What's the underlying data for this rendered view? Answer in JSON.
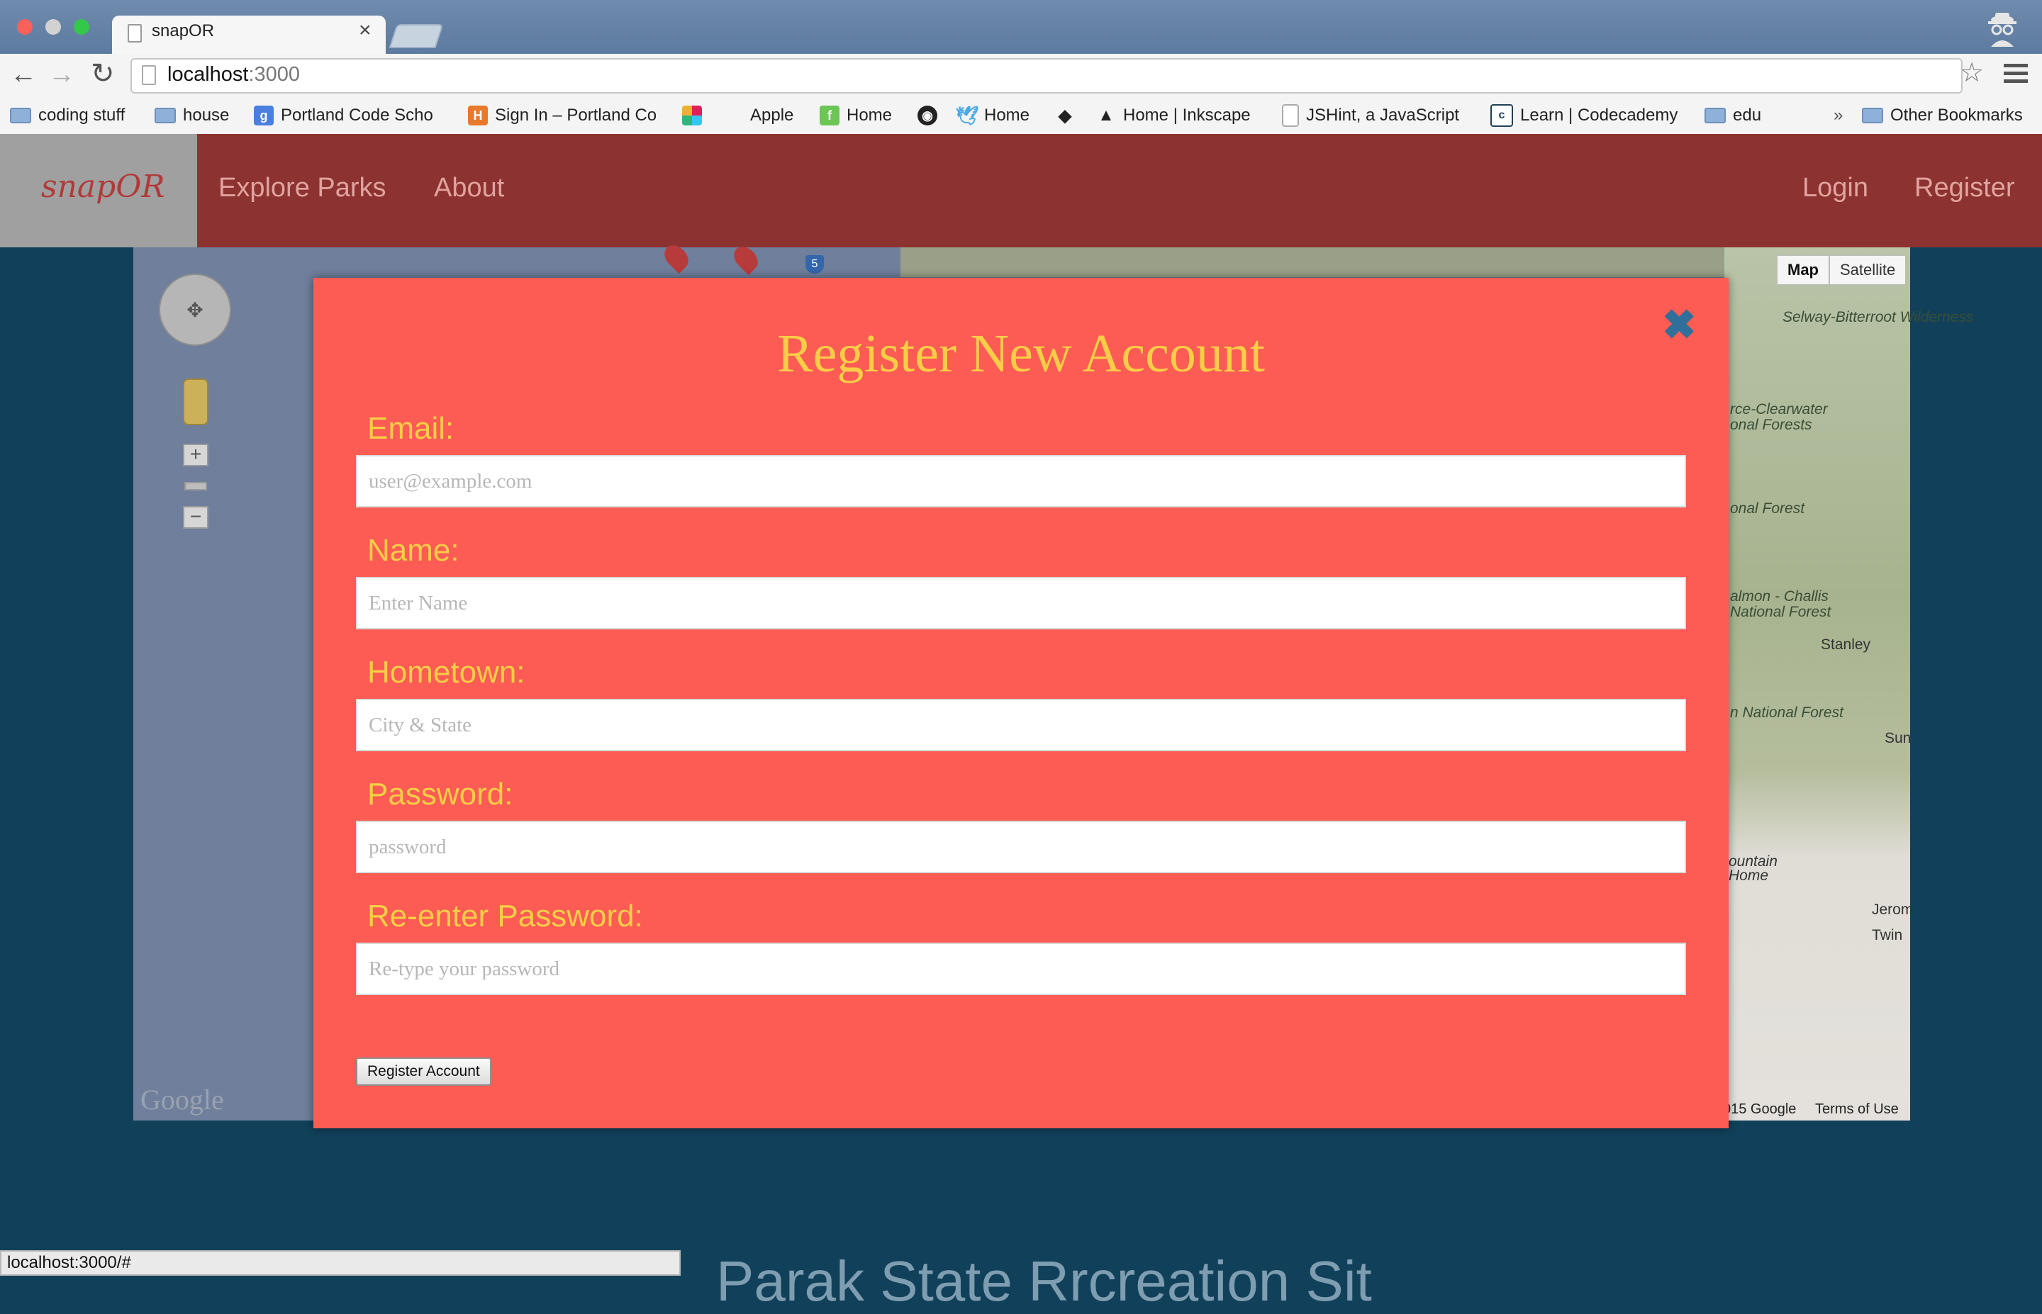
{
  "browser": {
    "tab_title": "snapOR",
    "url_host": "localhost",
    "url_port": ":3000",
    "bookmarks": [
      {
        "label": "coding stuff",
        "icon": "folder-icon"
      },
      {
        "label": "house",
        "icon": "folder-icon"
      },
      {
        "label": "Portland Code Scho",
        "icon": "google-sites-icon"
      },
      {
        "label": "Sign In – Portland Co",
        "icon": "h-icon"
      },
      {
        "label": "",
        "icon": "slack-icon"
      },
      {
        "label": "Apple",
        "icon": "apple-icon"
      },
      {
        "label": "Home",
        "icon": "feedly-icon"
      },
      {
        "label": "",
        "icon": "github-icon"
      },
      {
        "label": "Home",
        "icon": "twitter-icon"
      },
      {
        "label": "",
        "icon": "gem-icon"
      },
      {
        "label": "Home | Inkscape",
        "icon": "inkscape-icon"
      },
      {
        "label": "JSHint, a JavaScript",
        "icon": "page-icon"
      },
      {
        "label": "Learn | Codecademy",
        "icon": "codecademy-icon"
      },
      {
        "label": "edu",
        "icon": "folder-icon"
      }
    ],
    "overflow_chevron": "»",
    "other_bookmarks": "Other Bookmarks",
    "status_url": "localhost:3000/#"
  },
  "site": {
    "logo": "snapOR",
    "nav": [
      "Explore Parks",
      "About"
    ],
    "auth": [
      "Login",
      "Register"
    ],
    "bottom_heading": "Parak State Rrcreation Sit"
  },
  "map": {
    "type_buttons": [
      "Map",
      "Satellite"
    ],
    "active_type": "Map",
    "labels": [
      "Selway-Bitterroot Wilderness",
      "rce-Clearwater",
      "onal Forests",
      "onal Forest",
      "almon - Challis",
      "National Forest",
      "n National Forest",
      "ountain",
      "Home"
    ],
    "towns": [
      "Stanley",
      "Sun",
      "Jerom",
      "Twin"
    ],
    "interstate": "5",
    "google_logo": "Google",
    "copyright": "015 Google",
    "terms": "Terms of Use"
  },
  "modal": {
    "title": "Register New Account",
    "close_glyph": "✖",
    "fields": [
      {
        "label": "Email:",
        "placeholder": "user@example.com"
      },
      {
        "label": "Name:",
        "placeholder": "Enter Name"
      },
      {
        "label": "Hometown:",
        "placeholder": "City & State"
      },
      {
        "label": "Password:",
        "placeholder": "password"
      },
      {
        "label": "Re-enter Password:",
        "placeholder": "Re-type your password"
      }
    ],
    "submit_label": "Register Account"
  },
  "colors": {
    "header": "#8c3231",
    "modal_bg": "#fc5c54",
    "modal_text": "#f9cd47",
    "page_bg": "#11405a"
  }
}
